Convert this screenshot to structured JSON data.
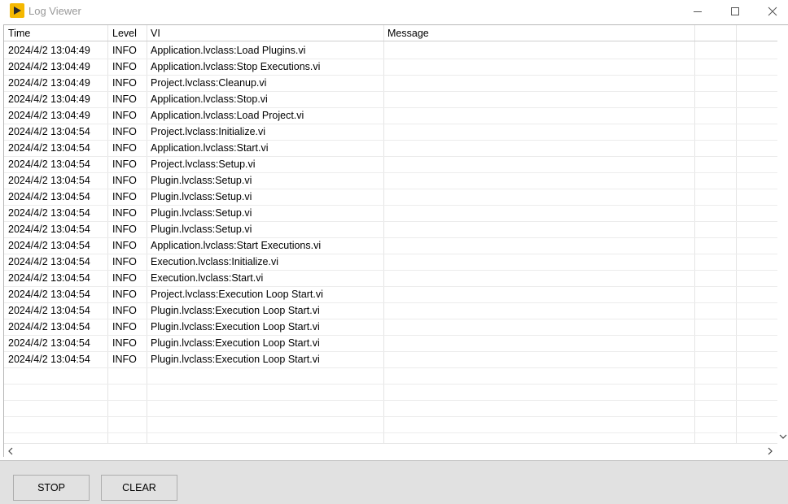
{
  "window": {
    "title": "Log Viewer"
  },
  "table": {
    "columns": [
      "Time",
      "Level",
      "VI",
      "Message"
    ],
    "rows": [
      {
        "time": "2024/4/2 13:04:49",
        "level": "INFO",
        "vi": "Application.lvclass:Load Plugins.vi",
        "message": ""
      },
      {
        "time": "2024/4/2 13:04:49",
        "level": "INFO",
        "vi": "Application.lvclass:Stop Executions.vi",
        "message": ""
      },
      {
        "time": "2024/4/2 13:04:49",
        "level": "INFO",
        "vi": "Project.lvclass:Cleanup.vi",
        "message": ""
      },
      {
        "time": "2024/4/2 13:04:49",
        "level": "INFO",
        "vi": "Application.lvclass:Stop.vi",
        "message": ""
      },
      {
        "time": "2024/4/2 13:04:49",
        "level": "INFO",
        "vi": "Application.lvclass:Load Project.vi",
        "message": ""
      },
      {
        "time": "2024/4/2 13:04:54",
        "level": "INFO",
        "vi": "Project.lvclass:Initialize.vi",
        "message": ""
      },
      {
        "time": "2024/4/2 13:04:54",
        "level": "INFO",
        "vi": "Application.lvclass:Start.vi",
        "message": ""
      },
      {
        "time": "2024/4/2 13:04:54",
        "level": "INFO",
        "vi": "Project.lvclass:Setup.vi",
        "message": ""
      },
      {
        "time": "2024/4/2 13:04:54",
        "level": "INFO",
        "vi": "Plugin.lvclass:Setup.vi",
        "message": ""
      },
      {
        "time": "2024/4/2 13:04:54",
        "level": "INFO",
        "vi": "Plugin.lvclass:Setup.vi",
        "message": ""
      },
      {
        "time": "2024/4/2 13:04:54",
        "level": "INFO",
        "vi": "Plugin.lvclass:Setup.vi",
        "message": ""
      },
      {
        "time": "2024/4/2 13:04:54",
        "level": "INFO",
        "vi": "Plugin.lvclass:Setup.vi",
        "message": ""
      },
      {
        "time": "2024/4/2 13:04:54",
        "level": "INFO",
        "vi": "Application.lvclass:Start Executions.vi",
        "message": ""
      },
      {
        "time": "2024/4/2 13:04:54",
        "level": "INFO",
        "vi": "Execution.lvclass:Initialize.vi",
        "message": ""
      },
      {
        "time": "2024/4/2 13:04:54",
        "level": "INFO",
        "vi": "Execution.lvclass:Start.vi",
        "message": ""
      },
      {
        "time": "2024/4/2 13:04:54",
        "level": "INFO",
        "vi": "Project.lvclass:Execution Loop Start.vi",
        "message": ""
      },
      {
        "time": "2024/4/2 13:04:54",
        "level": "INFO",
        "vi": "Plugin.lvclass:Execution Loop Start.vi",
        "message": ""
      },
      {
        "time": "2024/4/2 13:04:54",
        "level": "INFO",
        "vi": "Plugin.lvclass:Execution Loop Start.vi",
        "message": ""
      },
      {
        "time": "2024/4/2 13:04:54",
        "level": "INFO",
        "vi": "Plugin.lvclass:Execution Loop Start.vi",
        "message": ""
      },
      {
        "time": "2024/4/2 13:04:54",
        "level": "INFO",
        "vi": "Plugin.lvclass:Execution Loop Start.vi",
        "message": ""
      }
    ],
    "empty_rows": 4
  },
  "buttons": {
    "stop_label": "STOP",
    "clear_label": "CLEAR"
  },
  "colors": {
    "app_icon": "#f5b800",
    "app_icon_glyph": "#2a2a2a",
    "grid_line": "#e4e4e4"
  },
  "icons": {
    "app": "labview-run-icon",
    "minimize": "minimize-icon",
    "maximize": "maximize-icon",
    "close": "close-icon",
    "scroll_left": "chevron-left-icon",
    "scroll_right": "chevron-right-icon",
    "scroll_down": "chevron-down-icon"
  }
}
